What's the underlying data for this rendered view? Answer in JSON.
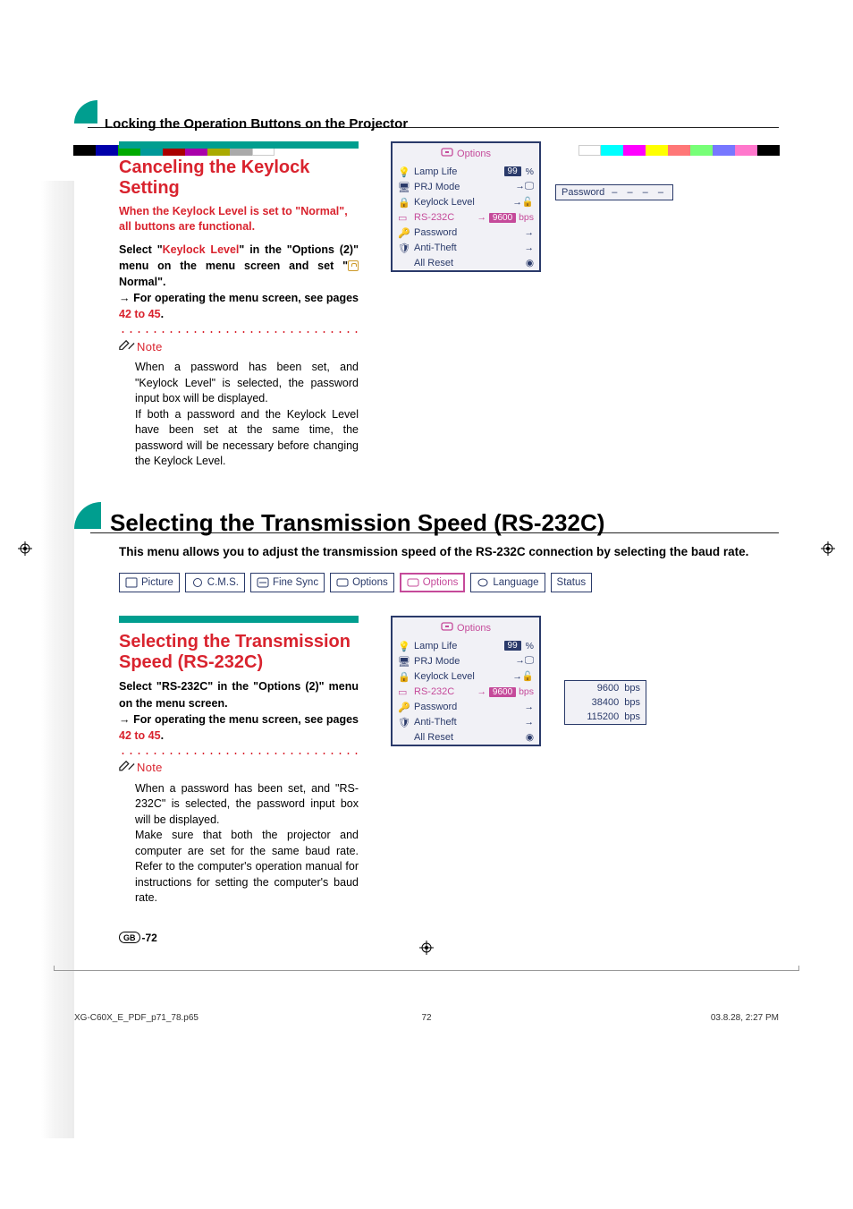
{
  "header": {
    "running_title": "Locking the Operation Buttons on the Projector"
  },
  "section1": {
    "heading": "Canceling the Keylock Setting",
    "sub": "When the Keylock Level is set to \"Normal\", all buttons are functional.",
    "body_p1_a": "Select \"",
    "body_p1_hl": "Keylock Level",
    "body_p1_b": "\" in the \"Options (2)\" menu on the menu screen and set \"",
    "body_p1_c": " Normal\".",
    "body_p2_a": "→ For operating the menu screen, see pages ",
    "body_p2_hl": "42 to 45",
    "body_p2_b": ".",
    "note_label": "Note",
    "note_p1": "When a password has been set, and \"Keylock Level\" is selected, the password input box will be displayed.",
    "note_p2": "If both a password and the Keylock Level have been set at the same time, the password will be necessary before changing the Keylock Level."
  },
  "osd1": {
    "title": "Options",
    "rows": {
      "lamp": "Lamp Life",
      "lamp_val": "99",
      "lamp_unit": "%",
      "prj": "PRJ Mode",
      "keylock": "Keylock Level",
      "rs": "RS-232C",
      "rs_val": "9600",
      "rs_unit": "bps",
      "pw": "Password",
      "anti": "Anti-Theft",
      "reset": "All Reset"
    },
    "pw_label": "Password",
    "pw_dashes": "– – – –"
  },
  "h1": {
    "title": "Selecting the Transmission Speed (RS-232C)",
    "intro": "This menu allows you to adjust the transmission speed of the RS-232C connection by selecting the baud rate."
  },
  "tabs": {
    "picture": "Picture",
    "cms": "C.M.S.",
    "fine": "Fine Sync",
    "opt1": "Options",
    "opt2": "Options",
    "lang": "Language",
    "status": "Status"
  },
  "section2": {
    "heading": "Selecting the Transmission Speed (RS-232C)",
    "body_p1": "Select \"RS-232C\" in the \"Options (2)\" menu on the menu screen.",
    "body_p2_a": "→ For operating the menu screen, see pages ",
    "body_p2_hl": "42 to 45",
    "body_p2_b": ".",
    "note_label": "Note",
    "note_p1": "When a password has been set, and \"RS-232C\" is selected, the password input box will be displayed.",
    "note_p2": "Make sure that both the projector and computer are set for the same baud rate. Refer to the computer's operation manual for instructions for setting the computer's baud rate."
  },
  "baud": {
    "r1": "9600",
    "r2": "38400",
    "r3": "115200",
    "unit": "bps"
  },
  "footer": {
    "gb": "GB",
    "page": "-72",
    "file": "XG-C60X_E_PDF_p71_78.p65",
    "num": "72",
    "ts": "03.8.28, 2:27 PM"
  }
}
